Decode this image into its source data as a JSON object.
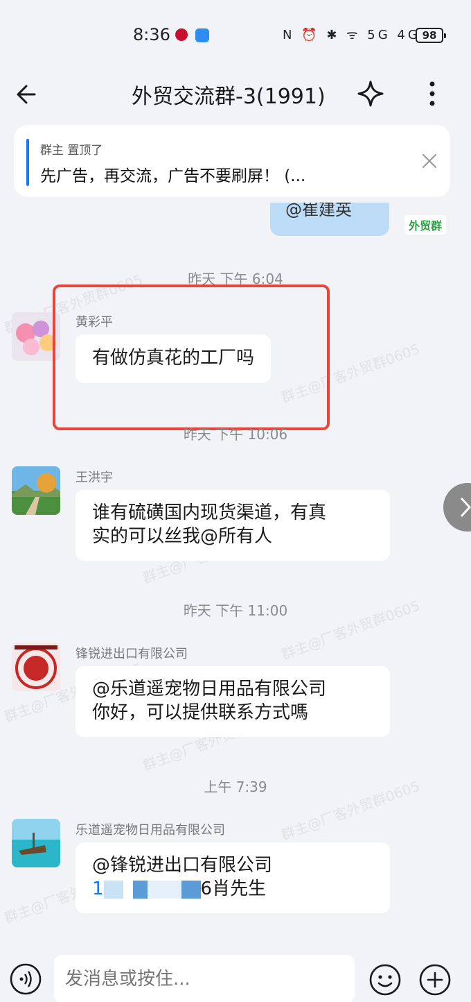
{
  "status_bar": {
    "time": "8:36",
    "icons_text": "N ⏰ ✱ ᯤ 5G 4G",
    "battery": "98"
  },
  "header": {
    "title": "外贸交流群-3(1991)"
  },
  "pinned": {
    "label": "群主 置顶了",
    "text": "先广告，再交流，广告不要刷屏！ (..."
  },
  "chat": {
    "partial_bubble_text": "@崔建英",
    "partial_badge": "外贸群",
    "timestamps": [
      "昨天  下午 6:04",
      "昨天  下午 10:06",
      "昨天  下午 11:00",
      "上午 7:39"
    ],
    "messages": [
      {
        "sender": "黄彩平",
        "lines": [
          "有做仿真花的工厂吗"
        ],
        "avatar_icon": "sponge-avatar-icon"
      },
      {
        "sender": "王洪宇",
        "lines": [
          "谁有硫磺国内现货渠道，有真",
          "实的可以丝我@所有人"
        ],
        "avatar_icon": "landscape-avatar-icon"
      },
      {
        "sender": "锋锐进出口有限公司",
        "lines": [
          "@乐道遥宠物日用品有限公司",
          "你好，可以提供联系方式嗎"
        ],
        "avatar_icon": "red-seal-avatar-icon"
      },
      {
        "sender": "乐道遥宠物日用品有限公司",
        "lines": [
          "@锋锐进出口有限公司",
          "1",
          "6肖先生"
        ],
        "avatar_icon": "beach-avatar-icon"
      }
    ],
    "watermark": "群主@厂客外贸群0605"
  },
  "input_bar": {
    "placeholder": "发消息或按住..."
  },
  "colors": {
    "accent": "#1677ff",
    "highlight": "#e8453c",
    "background": "#f2f3f7"
  }
}
